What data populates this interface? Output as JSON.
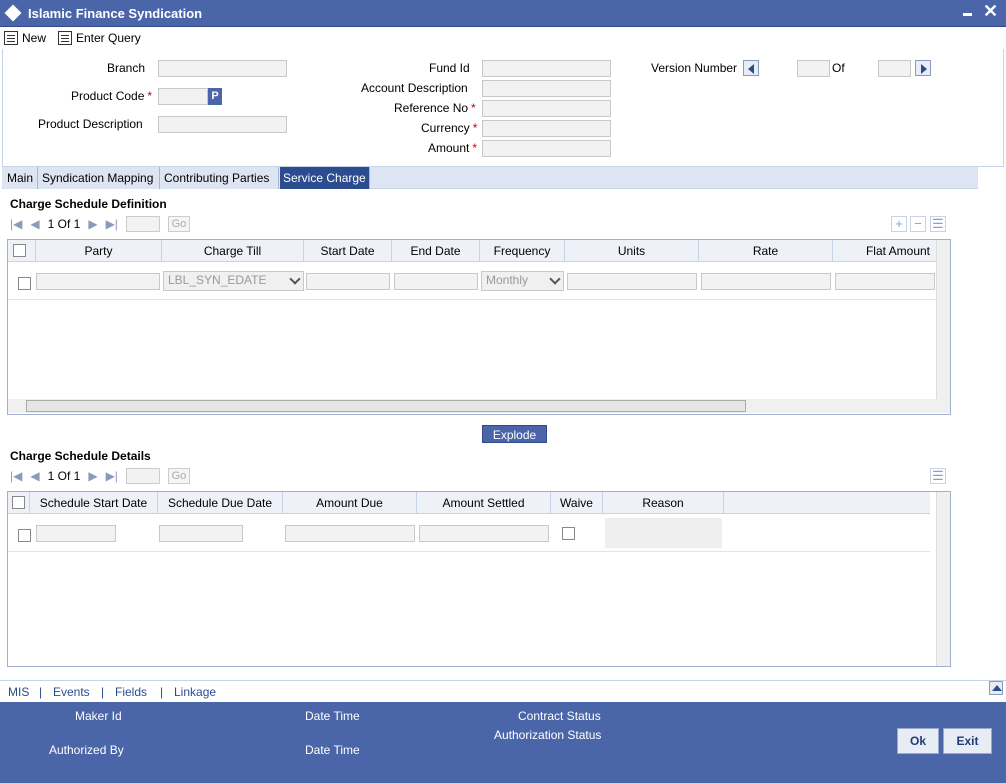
{
  "window": {
    "title": "Islamic Finance Syndication"
  },
  "toolbar": {
    "new_label": "New",
    "enter_query_label": "Enter Query"
  },
  "header": {
    "branch_label": "Branch",
    "product_code_label": "Product Code",
    "product_description_label": "Product Description",
    "fund_id_label": "Fund Id",
    "account_description_label": "Account Description",
    "reference_no_label": "Reference No",
    "currency_label": "Currency",
    "amount_label": "Amount",
    "version_number_label": "Version Number",
    "of_label": "Of",
    "p_button_label": "P",
    "required_marker": "*"
  },
  "tabs": [
    {
      "label": "Main"
    },
    {
      "label": "Syndication Mapping"
    },
    {
      "label": "Contributing Parties"
    },
    {
      "label": "Service Charge",
      "active": true
    }
  ],
  "schedule_definition": {
    "title": "Charge Schedule Definition",
    "pager": {
      "page": "1",
      "of_label": "Of",
      "total": "1",
      "go_label": "Go"
    },
    "columns": [
      "Party",
      "Charge Till",
      "Start Date",
      "End Date",
      "Frequency",
      "Units",
      "Rate",
      "Flat Amount"
    ],
    "row": {
      "charge_till": "LBL_SYN_EDATE",
      "frequency": "Monthly"
    }
  },
  "explode_label": "Explode",
  "schedule_details": {
    "title": "Charge Schedule Details",
    "pager": {
      "page": "1",
      "of_label": "Of",
      "total": "1",
      "go_label": "Go"
    },
    "columns": [
      "Schedule Start Date",
      "Schedule Due Date",
      "Amount Due",
      "Amount Settled",
      "Waive",
      "Reason"
    ]
  },
  "links": {
    "mis": "MIS",
    "events": "Events",
    "fields": "Fields",
    "linkage": "Linkage",
    "separator": "|"
  },
  "footer": {
    "maker_id_label": "Maker Id",
    "date_time_label": "Date Time",
    "contract_status_label": "Contract Status",
    "authorized_by_label": "Authorized By",
    "date_time_label_2": "Date Time",
    "authorization_status_label": "Authorization Status",
    "ok_label": "Ok",
    "exit_label": "Exit"
  },
  "colors": {
    "accent": "#4a66a8",
    "active_tab": "#2b4c8f",
    "required": "#cc0000"
  },
  "icons": [
    "diamond-icon",
    "minimize-icon",
    "close-icon",
    "new-icon",
    "enter-query-icon",
    "first-page-icon",
    "prev-page-icon",
    "next-page-icon",
    "last-page-icon",
    "add-row-icon",
    "delete-row-icon",
    "single-view-icon",
    "scroll-up-icon"
  ]
}
